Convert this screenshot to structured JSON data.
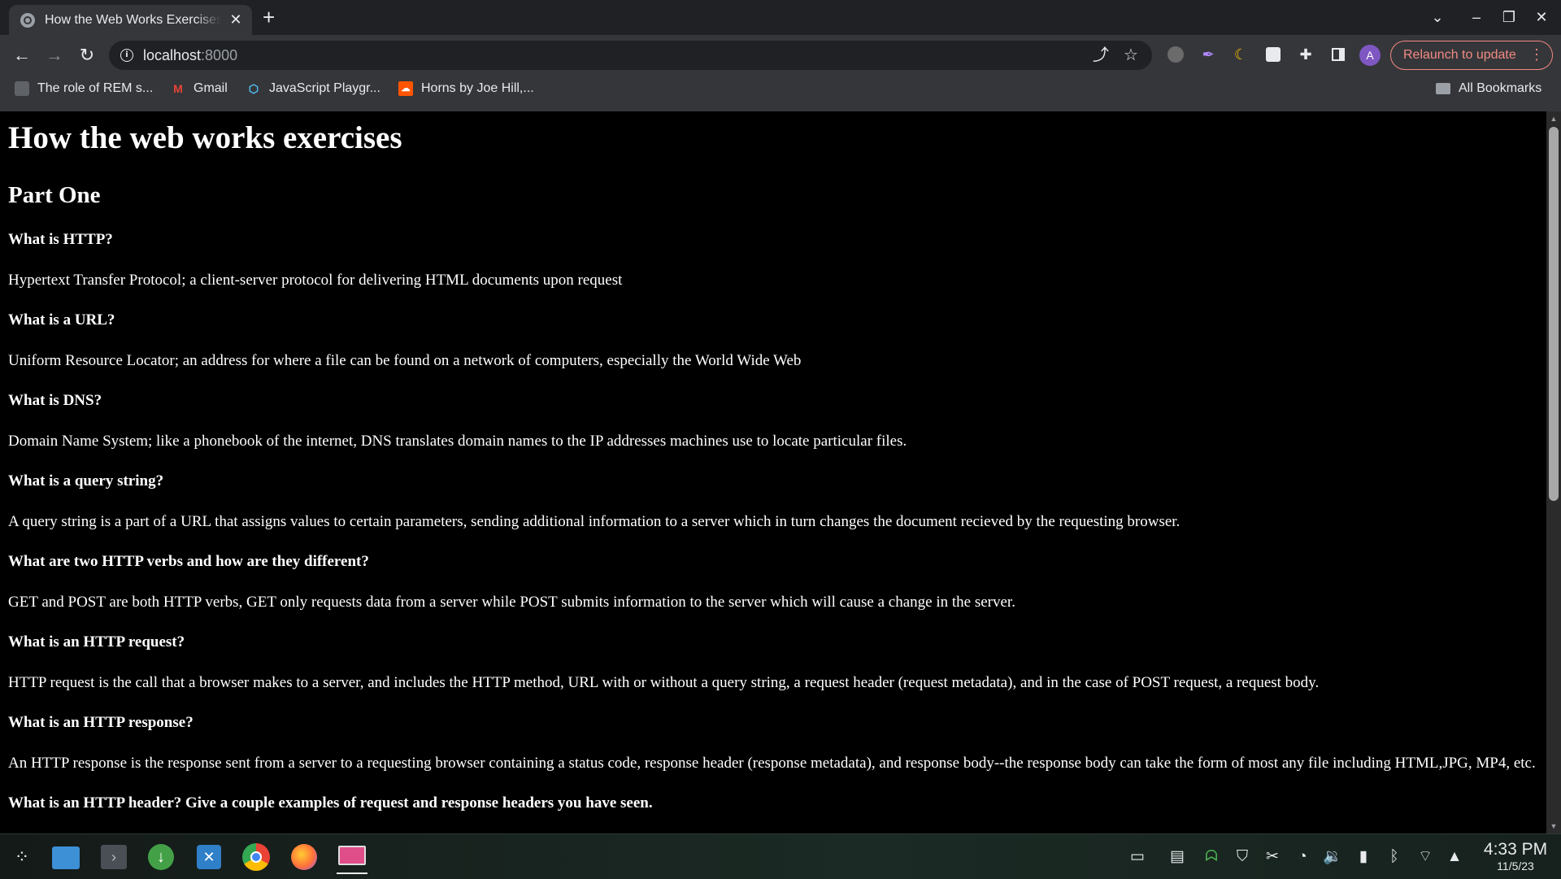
{
  "browser": {
    "tab_title": "How the Web Works Exercises",
    "url_host": "localhost",
    "url_port": ":8000",
    "relaunch_label": "Relaunch to update",
    "avatar_letter": "A",
    "bookmarks": [
      {
        "label": "The role of REM s...",
        "icon": "bookmark-page-icon"
      },
      {
        "label": "Gmail",
        "icon": "gmail-icon"
      },
      {
        "label": "JavaScript Playgr...",
        "icon": "playground-icon"
      },
      {
        "label": "Horns by Joe Hill,...",
        "icon": "soundcloud-icon"
      }
    ],
    "all_bookmarks_label": "All Bookmarks"
  },
  "page": {
    "title": "How the web works exercises",
    "section_title": "Part One",
    "qa": [
      {
        "q": "What is HTTP?",
        "a": "Hypertext Transfer Protocol; a client-server protocol for delivering HTML documents upon request"
      },
      {
        "q": "What is a URL?",
        "a": "Uniform Resource Locator; an address for where a file can be found on a network of computers, especially the World Wide Web"
      },
      {
        "q": "What is DNS?",
        "a": "Domain Name System; like a phonebook of the internet, DNS translates domain names to the IP addresses machines use to locate particular files."
      },
      {
        "q": "What is a query string?",
        "a": "A query string is a part of a URL that assigns values to certain parameters, sending additional information to a server which in turn changes the document recieved by the requesting browser."
      },
      {
        "q": "What are two HTTP verbs and how are they different?",
        "a": "GET and POST are both HTTP verbs, GET only requests data from a server while POST submits information to the server which will cause a change in the server."
      },
      {
        "q": "What is an HTTP request?",
        "a": "HTTP request is the call that a browser makes to a server, and includes the HTTP method, URL with or without a query string, a request header (request metadata), and in the case of POST request, a request body."
      },
      {
        "q": "What is an HTTP response?",
        "a": "An HTTP response is the response sent from a server to a requesting browser containing a status code, response header (response metadata), and response body--the response body can take the form of most any file including HTML,JPG, MP4, etc."
      },
      {
        "q": "What is an HTTP header? Give a couple examples of request and response headers you have seen.",
        "a": ""
      }
    ]
  },
  "taskbar": {
    "time": "4:33 PM",
    "date": "11/5/23"
  }
}
